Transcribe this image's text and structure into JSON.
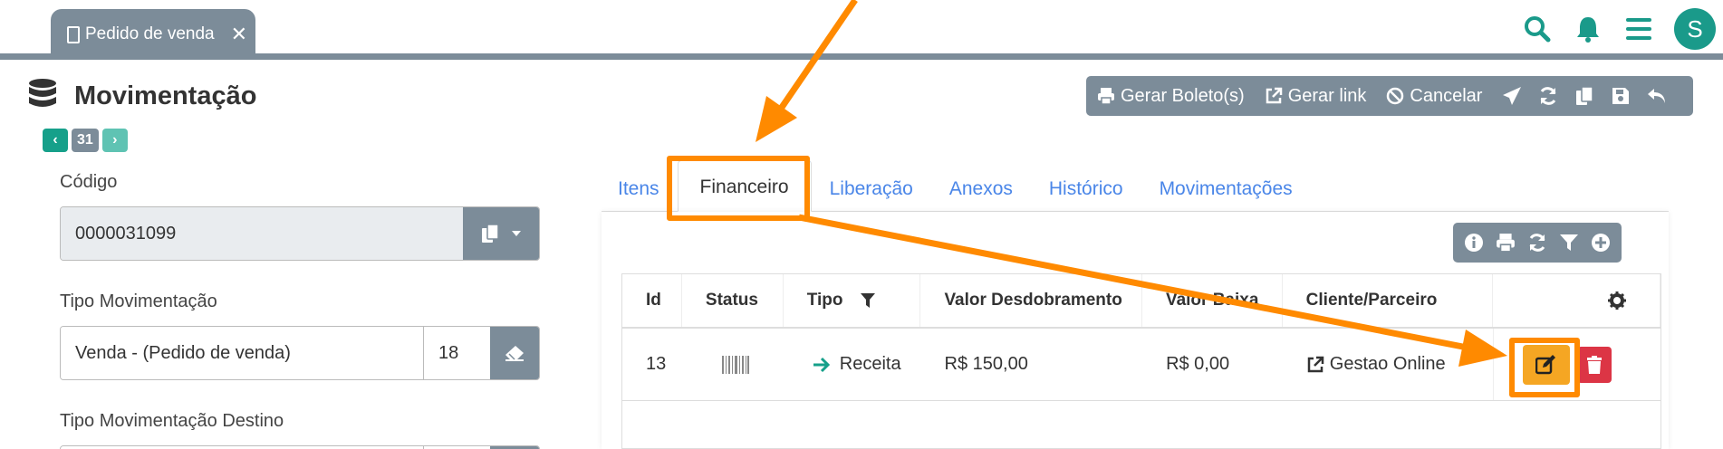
{
  "tab": {
    "label": "Pedido de venda"
  },
  "header": {
    "title": "Movimentação",
    "record_number": "31",
    "avatar_letter": "S"
  },
  "toolbar": {
    "gerar_boleto": "Gerar Boleto(s)",
    "gerar_link": "Gerar link",
    "cancelar": "Cancelar"
  },
  "form": {
    "codigo": {
      "label": "Código",
      "value": "0000031099"
    },
    "tipo_movimentacao": {
      "label": "Tipo Movimentação",
      "value": "Venda - (Pedido de venda)",
      "code": "18"
    },
    "tipo_movimentacao_destino": {
      "label": "Tipo Movimentação Destino"
    }
  },
  "tabs": [
    "Itens",
    "Financeiro",
    "Liberação",
    "Anexos",
    "Histórico",
    "Movimentações"
  ],
  "table": {
    "headers": [
      "Id",
      "Status",
      "Tipo",
      "Valor Desdobramento",
      "Valor Baixa",
      "Cliente/Parceiro"
    ],
    "rows": [
      {
        "id": "13",
        "tipo": "Receita",
        "valor_desdobramento": "R$ 150,00",
        "valor_baixa": "R$ 0,00",
        "cliente": "Gestao Online"
      }
    ]
  },
  "colors": {
    "accent": "#1a9a8a",
    "toolbar": "#7c8c99",
    "highlight": "#ff8a00",
    "edit": "#f5a623",
    "delete": "#dc3545"
  }
}
